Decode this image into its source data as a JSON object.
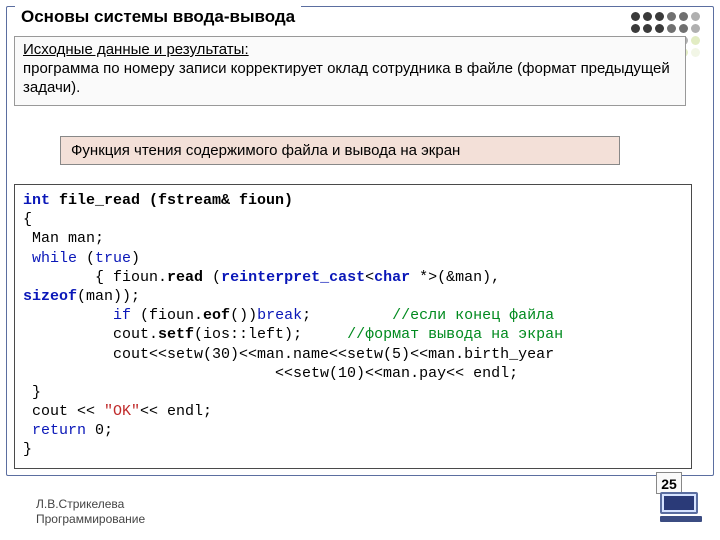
{
  "header": {
    "title": "Основы системы ввода-вывода"
  },
  "deco_colors": [
    "#3a3a3a",
    "#3a3a3a",
    "#3a3a3a",
    "#707070",
    "#707070",
    "#b0b0b0",
    "#3a3a3a",
    "#3a3a3a",
    "#3a3a3a",
    "#707070",
    "#707070",
    "#b0b0b0",
    "#707070",
    "#707070",
    "#707070",
    "#b0b0b0",
    "#b0b0b0",
    "#e2ecc3",
    "#b0b0b0",
    "#b0b0b0",
    "#b0b0b0",
    "#e2ecc3",
    "#e2ecc3",
    "#f2f6e6"
  ],
  "intro": {
    "title": "Исходные данные и результаты:",
    "body": "программа по номеру записи корректирует оклад сотрудника в файле (формат предыдущей задачи)."
  },
  "func_caption": "Функция чтения содержимого файла и вывода на экран",
  "code": {
    "l1a": "int",
    "l1b": " file_read (fstream& fioun)",
    "l2": "{",
    "l3": " Man man;",
    "l4a": " while",
    "l4b": " (",
    "l4c": "true",
    "l4d": ")",
    "l5a": "        { fioun.",
    "l5b": "read",
    "l5c": " (",
    "l5d": "reinterpret_cast",
    "l5e": "<",
    "l5f": "char",
    "l5g": " *>(&man),",
    "l6a": "sizeof",
    "l6b": "(man));",
    "l7a": "          if",
    "l7b": " (fioun.",
    "l7c": "eof",
    "l7d": "())",
    "l7e": "break",
    "l7f": ";         ",
    "l7g": "//если конец файла",
    "l8a": "          cout.",
    "l8b": "setf",
    "l8c": "(ios::left);     ",
    "l8d": "//формат вывода на экран",
    "l9": "          cout<<setw(30)<<man.name<<setw(5)<<man.birth_year",
    "l10": "                            <<setw(10)<<man.pay<< endl;",
    "l11": " }",
    "l12a": " cout << ",
    "l12b": "\"OK\"",
    "l12c": "<< endl;",
    "l13a": " return",
    "l13b": " 0;",
    "l14": "}"
  },
  "page_number": "25",
  "footer": {
    "author": "Л.В.Стрикелева",
    "course": "Программирование"
  }
}
